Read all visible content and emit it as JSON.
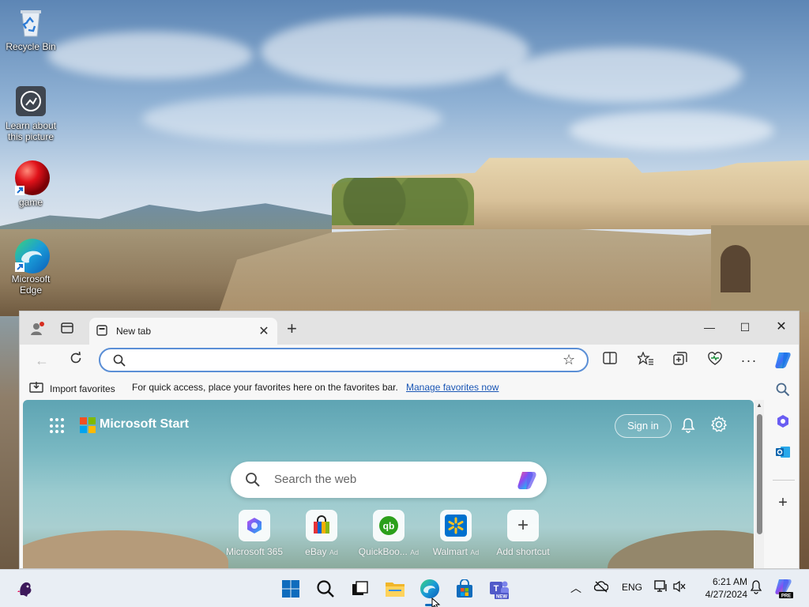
{
  "desktop": {
    "icons": [
      {
        "label": "Recycle Bin",
        "icon": "recycle-bin-icon"
      },
      {
        "label": "Learn about this picture",
        "icon": "camera-info-icon"
      },
      {
        "label": "game",
        "icon": "red-ball-icon"
      },
      {
        "label": "Microsoft Edge",
        "icon": "edge-icon"
      }
    ]
  },
  "browser": {
    "tab": {
      "title": "New tab"
    },
    "address": {
      "value": "",
      "placeholder": ""
    },
    "favorites_bar": {
      "import_label": "Import favorites",
      "message": "For quick access, place your favorites here on the favorites bar.",
      "link": "Manage favorites now"
    },
    "new_tab_page": {
      "brand": "Microsoft Start",
      "sign_in": "Sign in",
      "search_placeholder": "Search the web",
      "shortcuts": [
        {
          "label": "Microsoft 365",
          "ad": "",
          "icon": "microsoft-365-icon"
        },
        {
          "label": "eBay",
          "ad": "Ad",
          "icon": "ebay-bag-icon"
        },
        {
          "label": "QuickBoo...",
          "ad": "Ad",
          "icon": "quickbooks-icon"
        },
        {
          "label": "Walmart",
          "ad": "Ad",
          "icon": "walmart-spark-icon"
        },
        {
          "label": "Add shortcut",
          "ad": "",
          "icon": "plus-icon"
        }
      ]
    }
  },
  "taskbar": {
    "language": "ENG",
    "time": "6:21 AM",
    "date": "4/27/2024",
    "teams_badge": "NEW",
    "copilot_badge": "PRE"
  },
  "colors": {
    "accent": "#0f6cbd",
    "address_border": "#5b8fd6",
    "taskbar": "#e9eef4",
    "link": "#1a56b5"
  }
}
